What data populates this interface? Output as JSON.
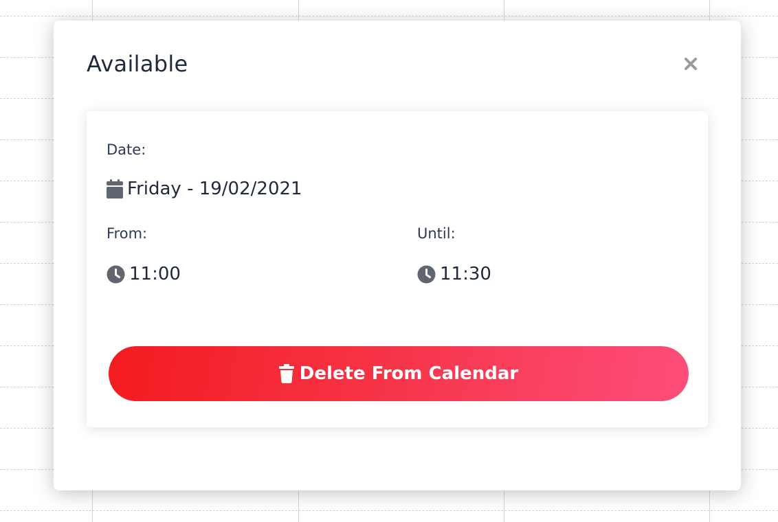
{
  "modal": {
    "title": "Available",
    "close_icon": "close-icon"
  },
  "details": {
    "date_label": "Date:",
    "date_value": "Friday - 19/02/2021",
    "date_icon": "calendar-icon",
    "from_label": "From:",
    "from_value": "11:00",
    "until_label": "Until:",
    "until_value": "11:30",
    "time_icon": "clock-icon"
  },
  "actions": {
    "delete_label": "Delete From Calendar",
    "delete_icon": "trash-icon",
    "delete_gradient": [
      "#f31b1f",
      "#fd4e7b"
    ]
  },
  "colors": {
    "title": "#1e2a3b",
    "label": "#2c3a57",
    "icon": "#5f6670",
    "close": "#9a9a9a"
  }
}
